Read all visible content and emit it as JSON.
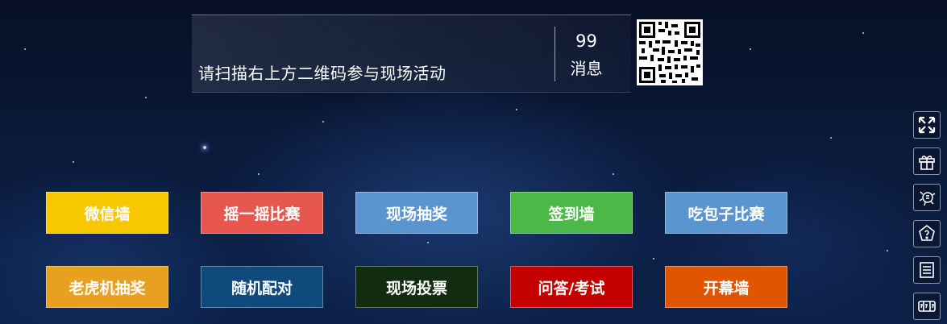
{
  "banner": {
    "instruction": "请扫描右上方二维码参与现场活动",
    "message_count": "99",
    "message_label": "消息",
    "qr_icon": "qr-code-icon"
  },
  "buttons": [
    {
      "label": "微信墙",
      "color": "#f7c800"
    },
    {
      "label": "摇一摇比赛",
      "color": "#e8574e"
    },
    {
      "label": "现场抽奖",
      "color": "#5b95cf"
    },
    {
      "label": "签到墙",
      "color": "#4cb848"
    },
    {
      "label": "吃包子比赛",
      "color": "#5b95cf"
    },
    {
      "label": "老虎机抽奖",
      "color": "#e8a020"
    },
    {
      "label": "随机配对",
      "color": "#0f4a7d"
    },
    {
      "label": "现场投票",
      "color": "#122c10"
    },
    {
      "label": "问答/考试",
      "color": "#c40000"
    },
    {
      "label": "开幕墙",
      "color": "#e05500"
    }
  ],
  "sidebar": [
    {
      "icon": "fullscreen-icon"
    },
    {
      "icon": "gift-icon"
    },
    {
      "icon": "lottery-icon"
    },
    {
      "icon": "question-icon"
    },
    {
      "icon": "list-icon"
    },
    {
      "icon": "slot-machine-icon"
    }
  ]
}
